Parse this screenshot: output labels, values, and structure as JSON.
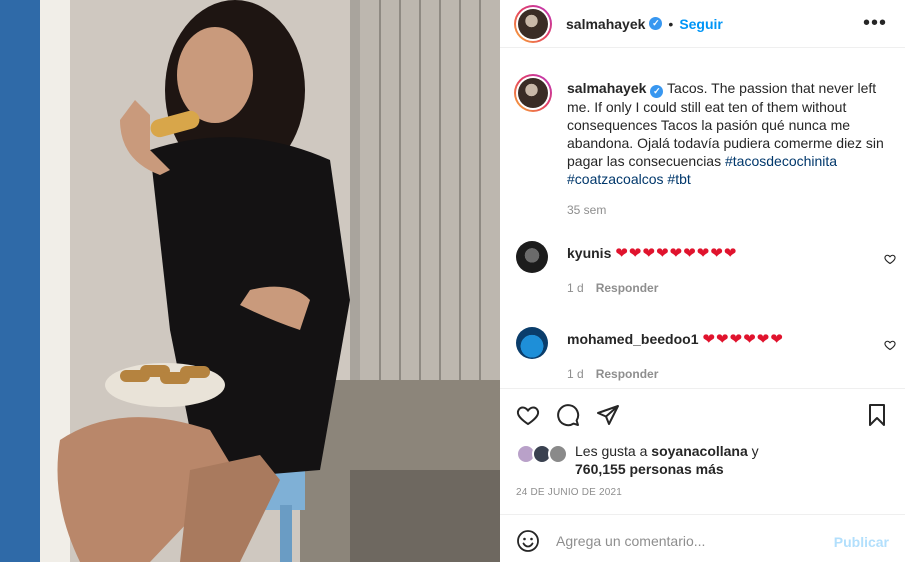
{
  "post": {
    "username": "salmahayek",
    "verified_icon": "verified-badge-icon",
    "separator": "•",
    "follow_label": "Seguir",
    "more_icon": "more-options-icon"
  },
  "caption": {
    "username": "salmahayek",
    "text": "Tacos. The passion that never left me. If only I could still eat ten of them without consequences Tacos la pasión qué nunca me abandona. Ojalá todavía pudiera comerme diez sin pagar las consecuencias",
    "hashtags": [
      "#tacosdecochinita",
      "#coatzacoalcos",
      "#tbt"
    ],
    "time": "35 sem"
  },
  "comments": [
    {
      "username": "kyunis",
      "hearts": "❤❤❤❤❤❤❤❤❤",
      "age": "1 d",
      "reply_label": "Responder"
    },
    {
      "username": "mohamed_beedoo1",
      "hearts": "❤❤❤❤❤❤",
      "age": "1 d",
      "reply_label": "Responder"
    }
  ],
  "actions": {
    "like_icon": "heart-icon",
    "comment_icon": "comment-bubble-icon",
    "share_icon": "paper-plane-icon",
    "save_icon": "bookmark-icon"
  },
  "likes": {
    "prefix": "Les gusta a",
    "user": "soyanacollana",
    "conjunction": "y",
    "count_text": "760,155 personas más"
  },
  "date": "24 DE JUNIO DE 2021",
  "composer": {
    "emoji_icon": "emoji-smile-icon",
    "placeholder": "Agrega un comentario...",
    "publish_label": "Publicar"
  },
  "colors": {
    "accent": "#0095f6",
    "publish_disabled": "#b2dffc",
    "heart_red": "#e0132d",
    "hashtag": "#00376b",
    "muted": "#8e8e8e"
  }
}
